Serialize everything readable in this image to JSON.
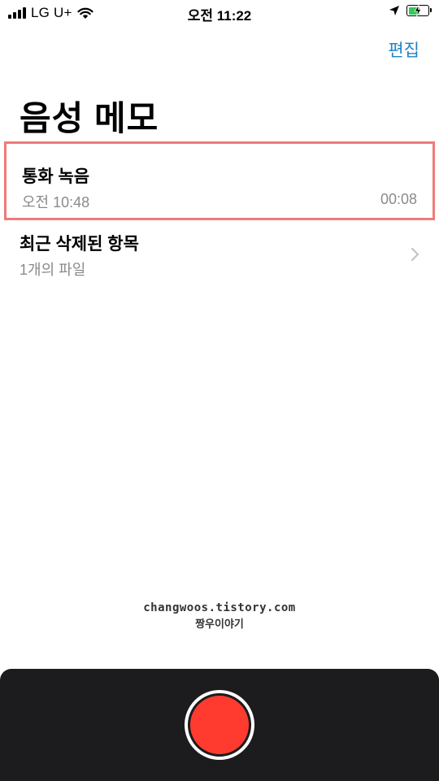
{
  "status_bar": {
    "carrier": "LG U+",
    "time": "오전 11:22",
    "colors": {
      "battery": "#34c759"
    },
    "icons": [
      "signal-icon",
      "wifi-icon",
      "location-arrow-icon",
      "battery-charging-icon"
    ]
  },
  "nav": {
    "edit_label": "편집",
    "title": "음성 메모",
    "accent_color": "#1f82c8"
  },
  "memos": [
    {
      "title": "통화 녹음",
      "date": "오전 10:48",
      "duration": "00:08",
      "highlight_color": "#f07a7a"
    }
  ],
  "recently_deleted": {
    "title": "최근 삭제된 항목",
    "subtitle": "1개의 파일",
    "icon": "chevron-right-icon"
  },
  "watermark": {
    "url": "changwoos.tistory.com",
    "name": "짱우이야기"
  },
  "record": {
    "button_color": "#ff3b30",
    "panel_color": "#1c1c1e",
    "icon": "record-icon"
  }
}
